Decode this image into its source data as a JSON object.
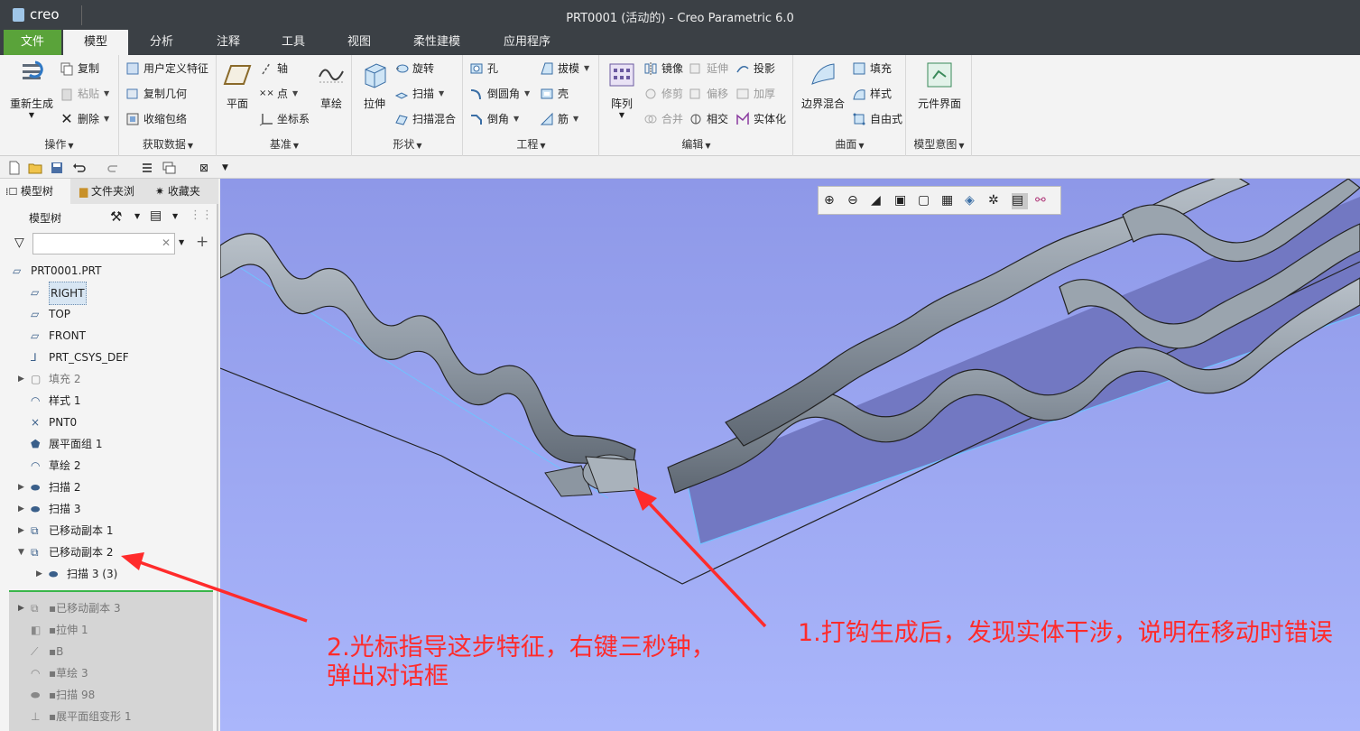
{
  "app": {
    "logo": "creo",
    "window_title": "PRT0001 (活动的) - Creo Parametric 6.0"
  },
  "tabs": [
    "文件",
    "模型",
    "分析",
    "注释",
    "工具",
    "视图",
    "柔性建模",
    "应用程序"
  ],
  "ribbon": {
    "operations": {
      "label": "操作",
      "regenerate": "重新生成",
      "copy": "复制",
      "paste": "粘贴",
      "delete": "删除"
    },
    "get_data": {
      "label": "获取数据",
      "udf": "用户定义特征",
      "copy_geom": "复制几何",
      "shrinkwrap": "收缩包络"
    },
    "datum": {
      "label": "基准",
      "plane": "平面",
      "axis": "轴",
      "point": "点",
      "csys": "坐标系",
      "sketch": "草绘"
    },
    "shapes": {
      "label": "形状",
      "extrude": "拉伸",
      "revolve": "旋转",
      "sweep": "扫描",
      "swept_blend": "扫描混合"
    },
    "engineering": {
      "label": "工程",
      "hole": "孔",
      "draft": "拔模",
      "round": "倒圆角",
      "shell": "壳",
      "chamfer": "倒角",
      "rib": "筋"
    },
    "editing": {
      "label": "编辑",
      "pattern": "阵列",
      "mirror": "镜像",
      "extend": "延伸",
      "project": "投影",
      "trim": "修剪",
      "offset": "偏移",
      "thicken": "加厚",
      "merge": "合并",
      "intersect": "相交",
      "solidify": "实体化"
    },
    "surfaces": {
      "label": "曲面",
      "boundary_blend": "边界混合",
      "fill": "填充",
      "style": "样式",
      "freestyle": "自由式"
    },
    "model_intent": {
      "label": "模型意图",
      "component_interface": "元件界面"
    }
  },
  "panel": {
    "tabs": [
      "模型树",
      "文件夹浏",
      "收藏夹"
    ],
    "header": "模型树",
    "filter_value": "",
    "tree": [
      {
        "label": "PRT0001.PRT",
        "icon": "part-icon"
      },
      {
        "label": "RIGHT",
        "icon": "datum-plane-icon"
      },
      {
        "label": "TOP",
        "icon": "datum-plane-icon"
      },
      {
        "label": "FRONT",
        "icon": "datum-plane-icon"
      },
      {
        "label": "PRT_CSYS_DEF",
        "icon": "csys-icon"
      },
      {
        "label": "填充 2",
        "icon": "fill-icon"
      },
      {
        "label": "样式 1",
        "icon": "style-icon"
      },
      {
        "label": "PNT0",
        "icon": "datum-point-icon"
      },
      {
        "label": "展平面组 1",
        "icon": "flatten-quilt-icon"
      },
      {
        "label": "草绘 2",
        "icon": "sketch-icon"
      },
      {
        "label": "扫描 2",
        "icon": "sweep-icon"
      },
      {
        "label": "扫描 3",
        "icon": "sweep-icon"
      },
      {
        "label": "已移动副本 1",
        "icon": "moved-copy-icon"
      },
      {
        "label": "已移动副本 2",
        "icon": "moved-copy-icon"
      },
      {
        "label": "扫描 3 (3)",
        "icon": "sweep-icon"
      },
      {
        "label": "已移动副本 3",
        "icon": "moved-copy-icon"
      },
      {
        "label": "拉伸 1",
        "icon": "extrude-icon"
      },
      {
        "label": "B",
        "icon": "graph-icon"
      },
      {
        "label": "草绘 3",
        "icon": "sketch-icon"
      },
      {
        "label": "扫描 98",
        "icon": "sweep-icon"
      },
      {
        "label": "展平面组变形 1",
        "icon": "flatten-deform-icon"
      }
    ]
  },
  "annotations": {
    "note1": "1.打钩生成后，发现实体干涉，说明在移动时错误",
    "note2_line1": "2.光标指导这步特征，右键三秒钟，",
    "note2_line2": "弹出对话框"
  },
  "colors": {
    "accent_green": "#5aa33a",
    "viewport_bg": "#a7b1f2",
    "annotation_red": "#ff2b2b",
    "titlebar": "#3b4045"
  }
}
